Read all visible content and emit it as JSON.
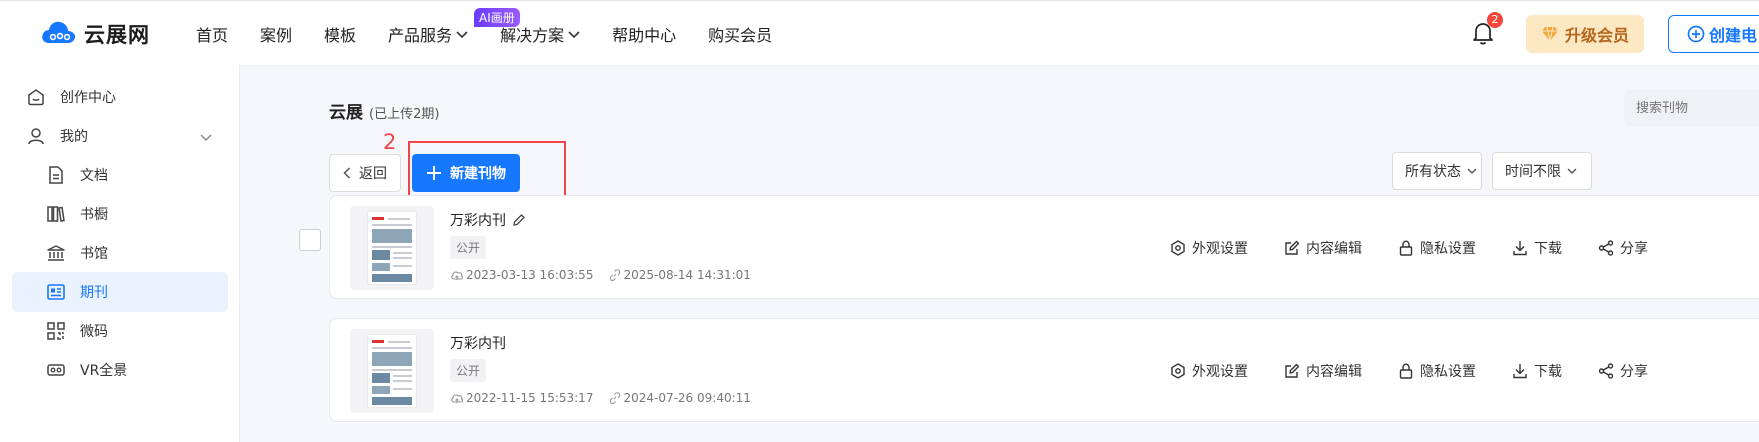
{
  "header": {
    "logo_text": "云展网",
    "nav": [
      {
        "label": "首页"
      },
      {
        "label": "案例"
      },
      {
        "label": "模板"
      },
      {
        "label": "产品服务"
      },
      {
        "label": "解决方案"
      },
      {
        "label": "帮助中心"
      },
      {
        "label": "购买会员"
      }
    ],
    "ai_badge": "AI画册",
    "notification_count": "2",
    "upgrade_label": "升级会员",
    "create_label": "创建电"
  },
  "sidebar": {
    "items": [
      {
        "label": "创作中心",
        "icon": "home-icon"
      },
      {
        "label": "我的",
        "icon": "user-icon"
      },
      {
        "label": "文档",
        "icon": "document-icon"
      },
      {
        "label": "书橱",
        "icon": "bookshelf-icon"
      },
      {
        "label": "书馆",
        "icon": "library-icon"
      },
      {
        "label": "期刊",
        "icon": "journal-icon"
      },
      {
        "label": "微码",
        "icon": "qrcode-icon"
      },
      {
        "label": "VR全景",
        "icon": "vr-icon"
      }
    ]
  },
  "main": {
    "title": "云展",
    "title_sub": "(已上传2期)",
    "search_placeholder": "搜索刊物",
    "back_label": "返回",
    "new_label": "新建刊物",
    "step_number": "2",
    "filters": [
      "所有状态",
      "时间不限"
    ],
    "cards": [
      {
        "name": "万彩内刊",
        "tag": "公开",
        "uploaded": "2023-03-13 16:03:55",
        "updated": "2025-08-14 14:31:01",
        "editable_name": true
      },
      {
        "name": "万彩内刊",
        "tag": "公开",
        "uploaded": "2022-11-15 15:53:17",
        "updated": "2024-07-26 09:40:11",
        "editable_name": false
      }
    ],
    "actions": [
      "外观设置",
      "内容编辑",
      "隐私设置",
      "下载",
      "分享"
    ]
  },
  "colors": {
    "primary": "#1677ff",
    "highlight": "#f0434c",
    "active_bg": "#eaf2ff",
    "upgrade_bg": "#fde8c4",
    "upgrade_text": "#b7651a"
  }
}
